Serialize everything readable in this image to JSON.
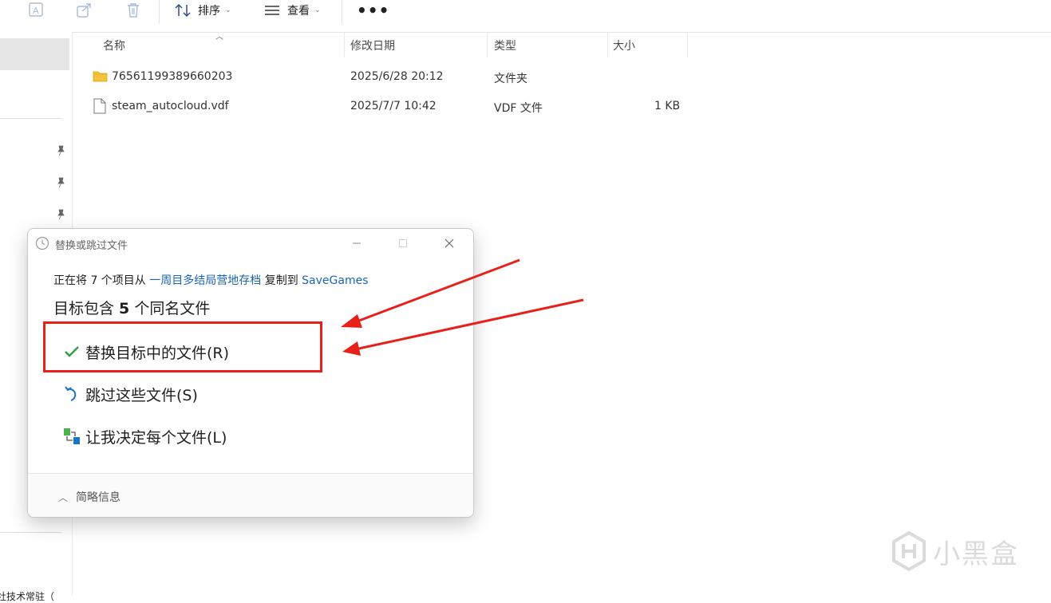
{
  "toolbar": {
    "sort_label": "排序",
    "view_label": "查看",
    "more_label": "•••",
    "icons": [
      "rename-icon",
      "share-icon",
      "delete-icon",
      "sort-icon",
      "view-icon"
    ]
  },
  "nav": {
    "bottom_text": "社技术常驻（"
  },
  "file_list": {
    "columns": {
      "name": "名称",
      "modified": "修改日期",
      "type": "类型",
      "size": "大小"
    },
    "rows": [
      {
        "name": "76561199389660203",
        "modified": "2025/6/28 20:12",
        "type": "文件夹",
        "size": "",
        "icon": "folder-icon"
      },
      {
        "name": "steam_autocloud.vdf",
        "modified": "2025/7/7 10:42",
        "type": "VDF 文件",
        "size": "1 KB",
        "icon": "file-icon"
      }
    ]
  },
  "dialog": {
    "title": "替换或跳过文件",
    "line_prefix": "正在将 7 个项目从 ",
    "source": "一周目多结局营地存档",
    "line_mid": " 复制到 ",
    "destination": "SaveGames",
    "heading_prefix": "目标包含 ",
    "heading_count": "5",
    "heading_suffix": " 个同名文件",
    "options": [
      {
        "label": "替换目标中的文件(R)",
        "icon": "checkmark-icon"
      },
      {
        "label": "跳过这些文件(S)",
        "icon": "undo-icon"
      },
      {
        "label": "让我决定每个文件(L)",
        "icon": "compare-icon"
      }
    ],
    "footer_label": "简略信息"
  },
  "watermark": {
    "text": "小黑盒"
  },
  "colors": {
    "annotation_red": "#e8201a",
    "link_blue": "#1a66b5",
    "check_green": "#2e9e3e",
    "folder_yellow": "#f5c33b"
  }
}
